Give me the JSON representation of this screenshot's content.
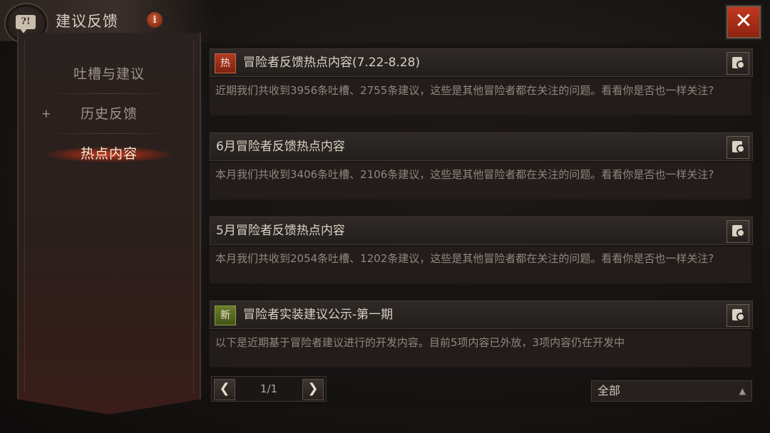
{
  "header": {
    "title": "建议反馈",
    "info_glyph": "i",
    "help_glyph": "?!",
    "close_glyph": "✕"
  },
  "sidebar": {
    "items": [
      {
        "label": "吐槽与建议",
        "active": false,
        "expandable": false
      },
      {
        "label": "历史反馈",
        "active": false,
        "expandable": true,
        "expand_glyph": "+"
      },
      {
        "label": "热点内容",
        "active": true,
        "expandable": false
      }
    ]
  },
  "cards": [
    {
      "badge": "热",
      "badge_type": "hot",
      "title": "冒险者反馈热点内容(7.22-8.28)",
      "body": "近期我们共收到3956条吐槽、2755条建议，这些是其他冒险者都在关注的问题。看看你是否也一样关注?"
    },
    {
      "badge": "",
      "badge_type": "none",
      "title": "6月冒险者反馈热点内容",
      "body": "本月我们共收到3406条吐槽、2106条建议，这些是其他冒险者都在关注的问题。看看你是否也一样关注?"
    },
    {
      "badge": "",
      "badge_type": "none",
      "title": "5月冒险者反馈热点内容",
      "body": "本月我们共收到2054条吐槽、1202条建议，这些是其他冒险者都在关注的问题。看看你是否也一样关注?"
    },
    {
      "badge": "新",
      "badge_type": "new",
      "title": "冒险者实装建议公示-第一期",
      "body": "以下是近期基于冒险者建议进行的开发内容。目前5项内容已外放，3项内容仍在开发中"
    }
  ],
  "pager": {
    "text": "1/1",
    "prev_glyph": "❮",
    "next_glyph": "❯"
  },
  "filter": {
    "selected": "全部",
    "arrow_glyph": "▲"
  },
  "colors": {
    "accent_red": "#b13b21",
    "new_green": "#6b7d2c",
    "background": "#171413"
  }
}
